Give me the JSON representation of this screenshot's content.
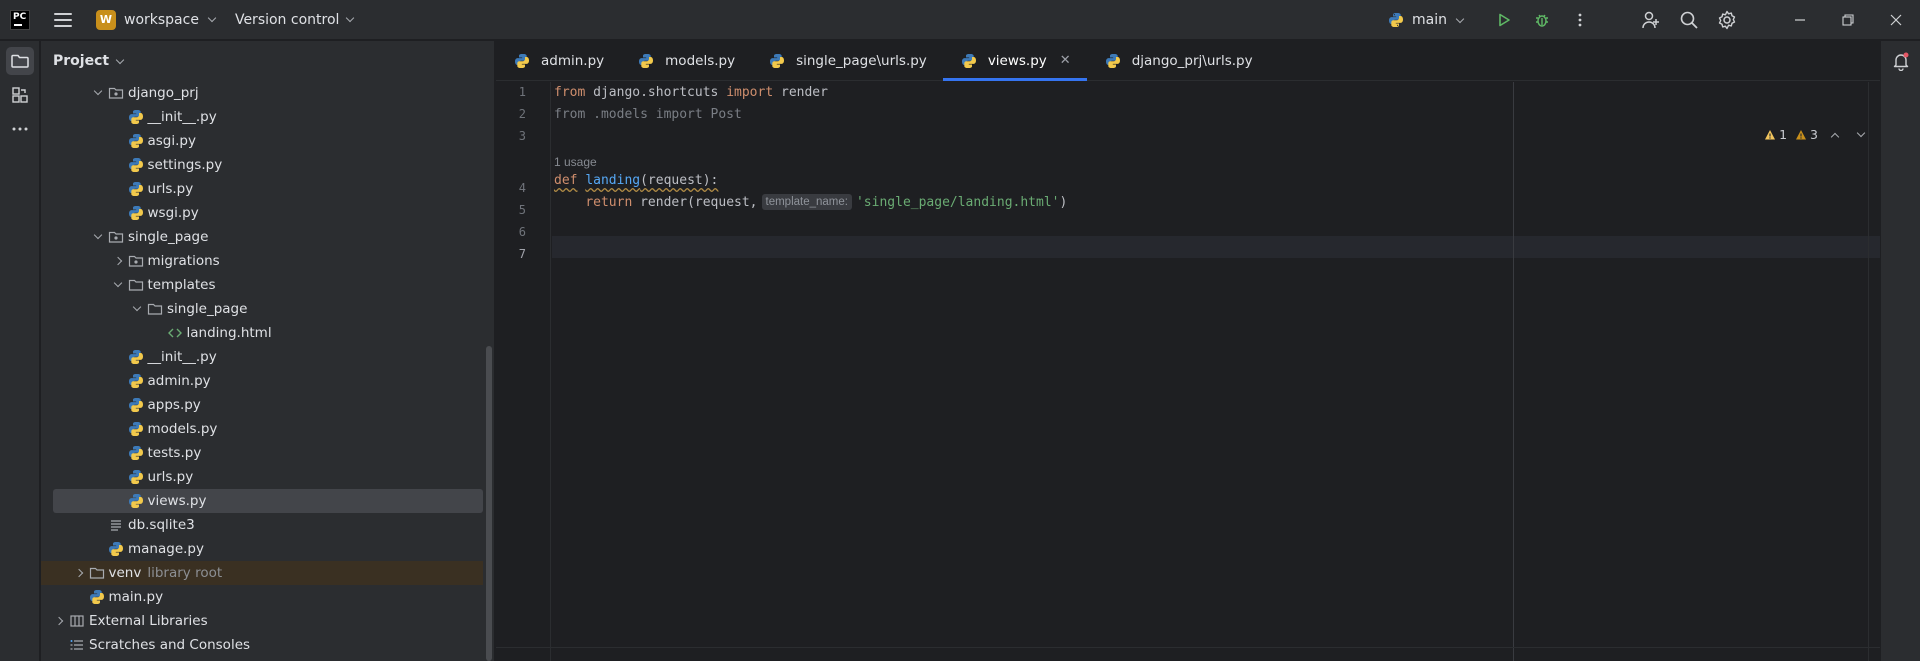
{
  "titlebar": {
    "logo": "PC",
    "project_badge": "W",
    "project_name": "workspace",
    "vcs_label": "Version control",
    "branch": "main"
  },
  "project_panel": {
    "title": "Project",
    "items": [
      {
        "label": "django_prj",
        "type": "package",
        "depth": 2,
        "expanded": true
      },
      {
        "label": "__init__.py",
        "type": "python",
        "depth": 3
      },
      {
        "label": "asgi.py",
        "type": "python",
        "depth": 3
      },
      {
        "label": "settings.py",
        "type": "python",
        "depth": 3
      },
      {
        "label": "urls.py",
        "type": "python",
        "depth": 3
      },
      {
        "label": "wsgi.py",
        "type": "python",
        "depth": 3
      },
      {
        "label": "single_page",
        "type": "package",
        "depth": 2,
        "expanded": true
      },
      {
        "label": "migrations",
        "type": "package",
        "depth": 3,
        "expanded": false
      },
      {
        "label": "templates",
        "type": "folder",
        "depth": 3,
        "expanded": true
      },
      {
        "label": "single_page",
        "type": "folder",
        "depth": 4,
        "expanded": true
      },
      {
        "label": "landing.html",
        "type": "html",
        "depth": 5
      },
      {
        "label": "__init__.py",
        "type": "python",
        "depth": 3
      },
      {
        "label": "admin.py",
        "type": "python",
        "depth": 3
      },
      {
        "label": "apps.py",
        "type": "python",
        "depth": 3
      },
      {
        "label": "models.py",
        "type": "python",
        "depth": 3
      },
      {
        "label": "tests.py",
        "type": "python",
        "depth": 3
      },
      {
        "label": "urls.py",
        "type": "python",
        "depth": 3
      },
      {
        "label": "views.py",
        "type": "python",
        "depth": 3,
        "selected": true
      },
      {
        "label": "db.sqlite3",
        "type": "db",
        "depth": 2
      },
      {
        "label": "manage.py",
        "type": "python",
        "depth": 2
      },
      {
        "label": "venv",
        "type": "folder",
        "depth": 1,
        "expanded": false,
        "suffix": "library root"
      },
      {
        "label": "main.py",
        "type": "python",
        "depth": 1
      },
      {
        "label": "External Libraries",
        "type": "library",
        "depth": 0,
        "expanded": false
      },
      {
        "label": "Scratches and Consoles",
        "type": "scratch",
        "depth": 0
      }
    ]
  },
  "tabs": [
    {
      "label": "admin.py",
      "active": false
    },
    {
      "label": "models.py",
      "active": false
    },
    {
      "label": "single_page\\urls.py",
      "active": false
    },
    {
      "label": "views.py",
      "active": true,
      "closable": true
    },
    {
      "label": "django_prj\\urls.py",
      "active": false
    }
  ],
  "editor": {
    "line_numbers": [
      "1",
      "2",
      "3",
      "4",
      "5",
      "6",
      "7"
    ],
    "current_line": "7",
    "usage_hint": "1 usage",
    "param_hint": "template_name:",
    "inspections": {
      "warnings": "1",
      "weak_warnings": "3"
    },
    "code": {
      "l1_kw1": "from",
      "l1_mod": " django.shortcuts ",
      "l1_kw2": "import",
      "l1_name": " render",
      "l2_text": "from .models import Post",
      "l4_kw": "def",
      "l4_fn": "landing",
      "l4_rest": "(request):",
      "l5_indent": "    ",
      "l5_kw": "return",
      "l5_call": " render(request,",
      "l5_str": "'single_page/landing.html'",
      "l5_end": ")"
    }
  },
  "colors": {
    "accent": "#3574f0",
    "keyword": "#cf8e6d",
    "function": "#56a8f5",
    "string": "#6aab73",
    "warning": "#f2c55c",
    "python_blue": "#3d7ab8",
    "python_yellow": "#f2c94c"
  },
  "icons": {
    "project": "folder-icon",
    "structure": "structure-icon",
    "more": "more-icon",
    "run": "run-icon",
    "debug": "debug-icon",
    "notifications": "bell-icon"
  }
}
